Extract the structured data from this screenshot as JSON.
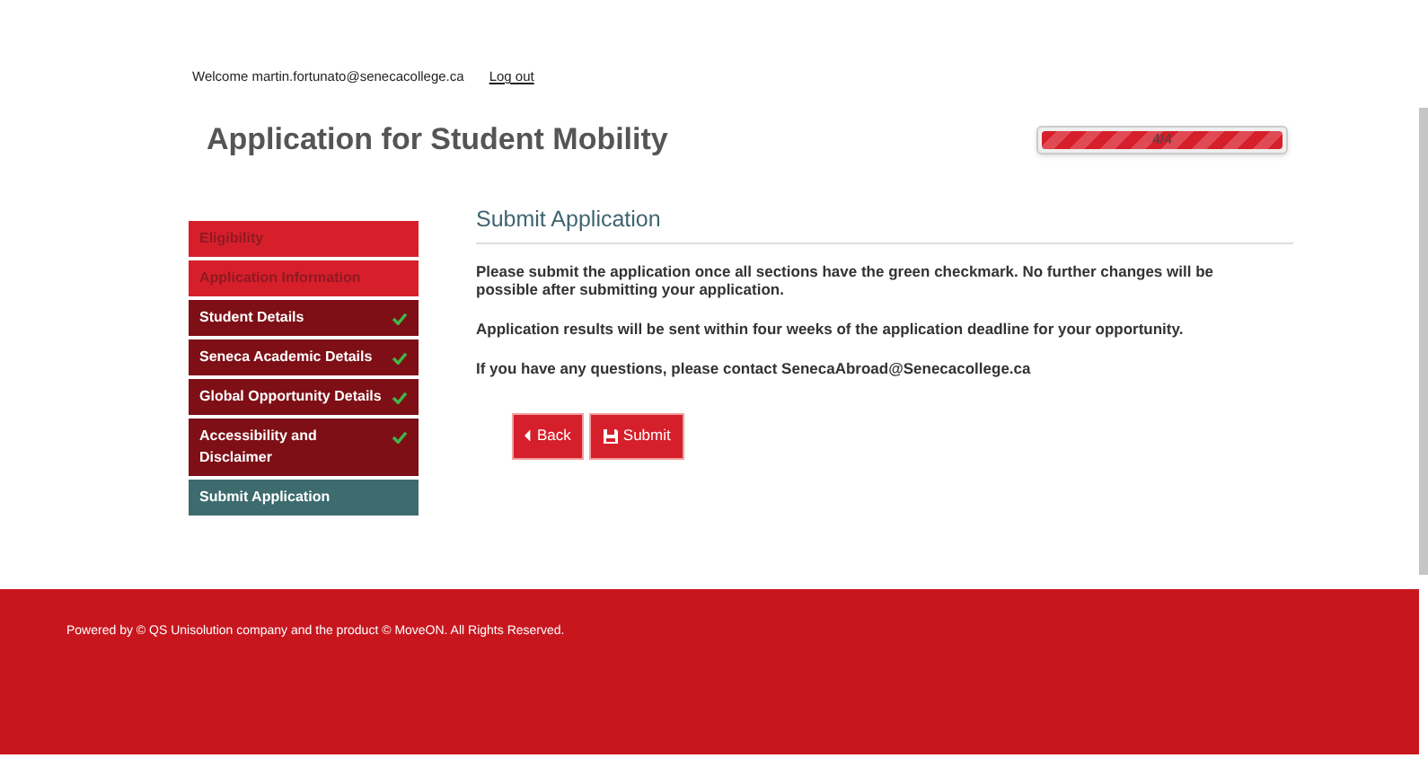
{
  "header": {
    "welcome": "Welcome martin.fortunato@senecacollege.ca",
    "logout": "Log out",
    "title": "Application for Student Mobility"
  },
  "progress": {
    "label": "4/4",
    "level": 1
  },
  "sidebar": {
    "items": [
      {
        "label": "Eligibility",
        "disabled": true,
        "completed": false,
        "selected": false
      },
      {
        "label": "Application Information",
        "disabled": true,
        "completed": false,
        "selected": false
      },
      {
        "label": "Student Details",
        "disabled": false,
        "completed": true,
        "selected": false
      },
      {
        "label": "Seneca Academic Details",
        "disabled": false,
        "completed": true,
        "selected": false
      },
      {
        "label": "Global Opportunity Details",
        "disabled": false,
        "completed": true,
        "selected": false
      },
      {
        "label": "Accessibility and Disclaimer",
        "disabled": false,
        "completed": true,
        "selected": false
      },
      {
        "label": "Submit Application",
        "disabled": false,
        "completed": false,
        "selected": true
      }
    ]
  },
  "main": {
    "heading": "Submit Application",
    "paragraphs": [
      "Please submit the application once all sections have the green checkmark. No further changes will be possible after submitting your application.",
      "Application results will be sent within four weeks of the application deadline for your opportunity.",
      "If you have any questions, please contact SenecaAbroad@Senecacollege.ca"
    ],
    "buttons": [
      {
        "label": "Back",
        "kind": "back"
      },
      {
        "label": "Submit",
        "kind": "submit"
      }
    ]
  },
  "footer": {
    "text": "Powered by © QS Unisolution company and the product © MoveON. All Rights Reserved."
  }
}
